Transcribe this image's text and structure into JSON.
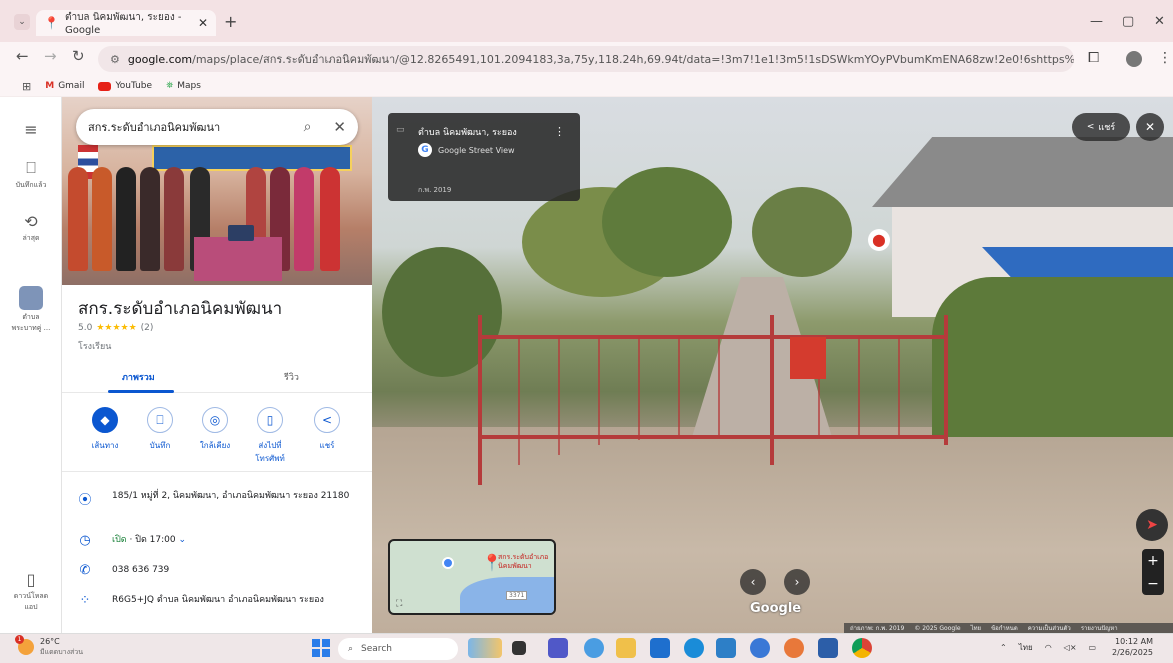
{
  "browser": {
    "tab_title": "ตำบล นิคมพัฒนา, ระยอง - Google",
    "url_host": "google.com",
    "url_path": "/maps/place/สกร.ระดับอำเภอนิคมพัฒนา/@12.8265491,101.2094183,3a,75y,118.24h,69.94t/data=!3m7!1e1!3m5!1sDSWkmYOyPVbumKmENA68zw!2e0!6shttps%3A%2F%2Fstreetviewp...",
    "bookmarks": [
      {
        "label": "Gmail",
        "icon": "gmail-icon"
      },
      {
        "label": "YouTube",
        "icon": "youtube-icon"
      },
      {
        "label": "Maps",
        "icon": "maps-icon"
      }
    ]
  },
  "rail": {
    "saved_label": "บันทึกแล้ว",
    "recent_label": "ล่าสุด",
    "place_label": "ตำบล\nพระบาทคู่ ...",
    "download_label": "ดาวน์โหลด\nแอป"
  },
  "place": {
    "search_value": "สกร.ระดับอำเภอนิคมพัฒนา",
    "title": "สกร.ระดับอำเภอนิคมพัฒนา",
    "rating": "5.0",
    "stars": "★★★★★",
    "review_count": "(2)",
    "type": "โรงเรียน",
    "tabs": [
      "ภาพรวม",
      "รีวิว"
    ],
    "actions": [
      {
        "label": "เส้นทาง",
        "icon": "directions-icon"
      },
      {
        "label": "บันทึก",
        "icon": "bookmark-icon"
      },
      {
        "label": "ใกล้เคียง",
        "icon": "nearby-icon"
      },
      {
        "label": "ส่งไปที่\nโทรศัพท์",
        "icon": "send-to-phone-icon"
      },
      {
        "label": "แชร์",
        "icon": "share-icon"
      }
    ],
    "address": "185/1 หมู่ที่ 2, นิคมพัฒนา, อำเภอนิคมพัฒนา ระยอง 21180",
    "hours_status": "เปิด",
    "hours_detail": "· ปิด 17:00",
    "phone": "038 636 739",
    "plus_code": "R6G5+JQ ตำบล นิคมพัฒนา อำเภอนิคมพัฒนา ระยอง"
  },
  "streetview": {
    "card_title": "ตำบล นิคมพัฒนา, ระยอง",
    "card_source": "Google Street View",
    "card_date": "ก.พ. 2019",
    "share_label": "แชร์",
    "minimap_label": "สกร.ระดับอำเภอนิคมพัฒนา",
    "minimap_route": "3371",
    "watermark": "Google",
    "footer": [
      "ถ่ายภาพ: ก.พ. 2019",
      "© 2025 Google",
      "ไทย",
      "ข้อกำหนด",
      "ความเป็นส่วนตัว",
      "รายงานปัญหา"
    ]
  },
  "taskbar": {
    "temperature": "26°C",
    "weather_text": "มีแดดบางส่วน",
    "weather_badge": "1",
    "search_placeholder": "Search",
    "lang": "ไทย",
    "time": "10:12 AM",
    "date": "2/26/2025"
  }
}
